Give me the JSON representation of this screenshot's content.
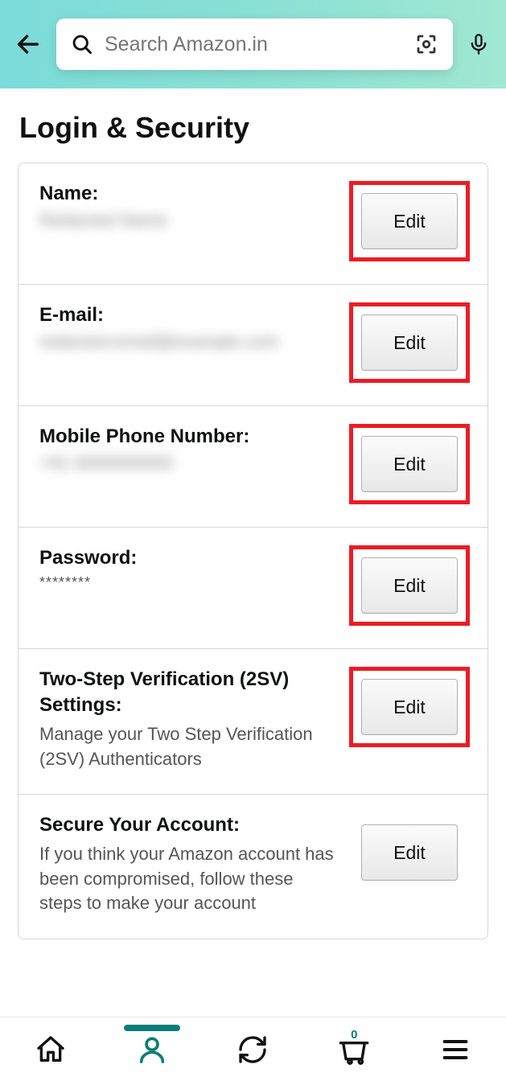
{
  "header": {
    "search_placeholder": "Search Amazon.in"
  },
  "page": {
    "title": "Login & Security"
  },
  "rows": {
    "name": {
      "label": "Name:",
      "value": "Redacted Name",
      "edit": "Edit",
      "highlighted": true,
      "blurred": true
    },
    "email": {
      "label": "E-mail:",
      "value": "redacted.email@example.com",
      "edit": "Edit",
      "highlighted": true,
      "blurred": true
    },
    "mobile": {
      "label": "Mobile Phone Number:",
      "value": "+91 0000000000",
      "edit": "Edit",
      "highlighted": true,
      "blurred": true
    },
    "password": {
      "label": "Password:",
      "value": "********",
      "edit": "Edit",
      "highlighted": true,
      "blurred": false
    },
    "twosv": {
      "label": "Two-Step Verification (2SV) Settings:",
      "desc": "Manage your Two Step Verification (2SV) Authenticators",
      "edit": "Edit",
      "highlighted": true
    },
    "secure": {
      "label": "Secure Your Account:",
      "desc": "If you think your Amazon account has been compromised, follow these steps to make your account",
      "edit": "Edit",
      "highlighted": false
    }
  },
  "cart_count": "0"
}
